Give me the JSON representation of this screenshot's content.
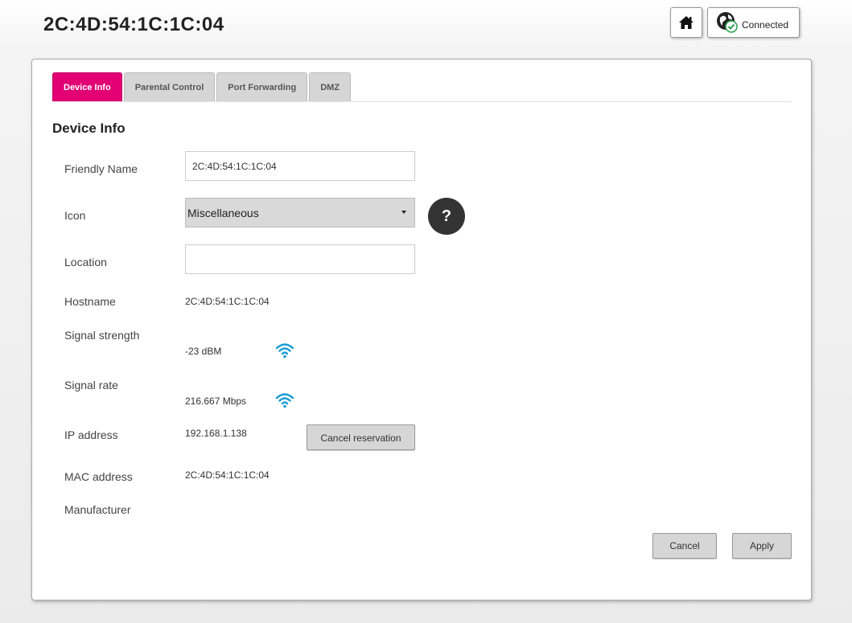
{
  "header": {
    "title": "2C:4D:54:1C:1C:04",
    "home_icon": "home-icon",
    "connection_icon": "globe-check-icon",
    "connection_label": "Connected"
  },
  "tabs": [
    {
      "label": "Device Info",
      "active": true
    },
    {
      "label": "Parental Control",
      "active": false
    },
    {
      "label": "Port Forwarding",
      "active": false
    },
    {
      "label": "DMZ",
      "active": false
    }
  ],
  "section_title": "Device Info",
  "fields": {
    "friendly_name": {
      "label": "Friendly Name",
      "value": "2C:4D:54:1C:1C:04"
    },
    "icon": {
      "label": "Icon",
      "value": "Miscellaneous",
      "help": "?"
    },
    "location": {
      "label": "Location",
      "value": ""
    },
    "hostname": {
      "label": "Hostname",
      "value": "2C:4D:54:1C:1C:04"
    },
    "signal_strength": {
      "label": "Signal strength",
      "value": "-23 dBM",
      "icon": "wifi-icon"
    },
    "signal_rate": {
      "label": "Signal rate",
      "value": "216.667 Mbps",
      "icon": "wifi-icon"
    },
    "ip_address": {
      "label": "IP address",
      "value": "192.168.1.138",
      "button": "Cancel reservation"
    },
    "mac_address": {
      "label": "MAC address",
      "value": "2C:4D:54:1C:1C:04"
    },
    "manufacturer": {
      "label": "Manufacturer",
      "value": ""
    }
  },
  "actions": {
    "cancel": "Cancel",
    "apply": "Apply"
  },
  "colors": {
    "accent": "#e20074",
    "wifi": "#1a9bd7"
  }
}
